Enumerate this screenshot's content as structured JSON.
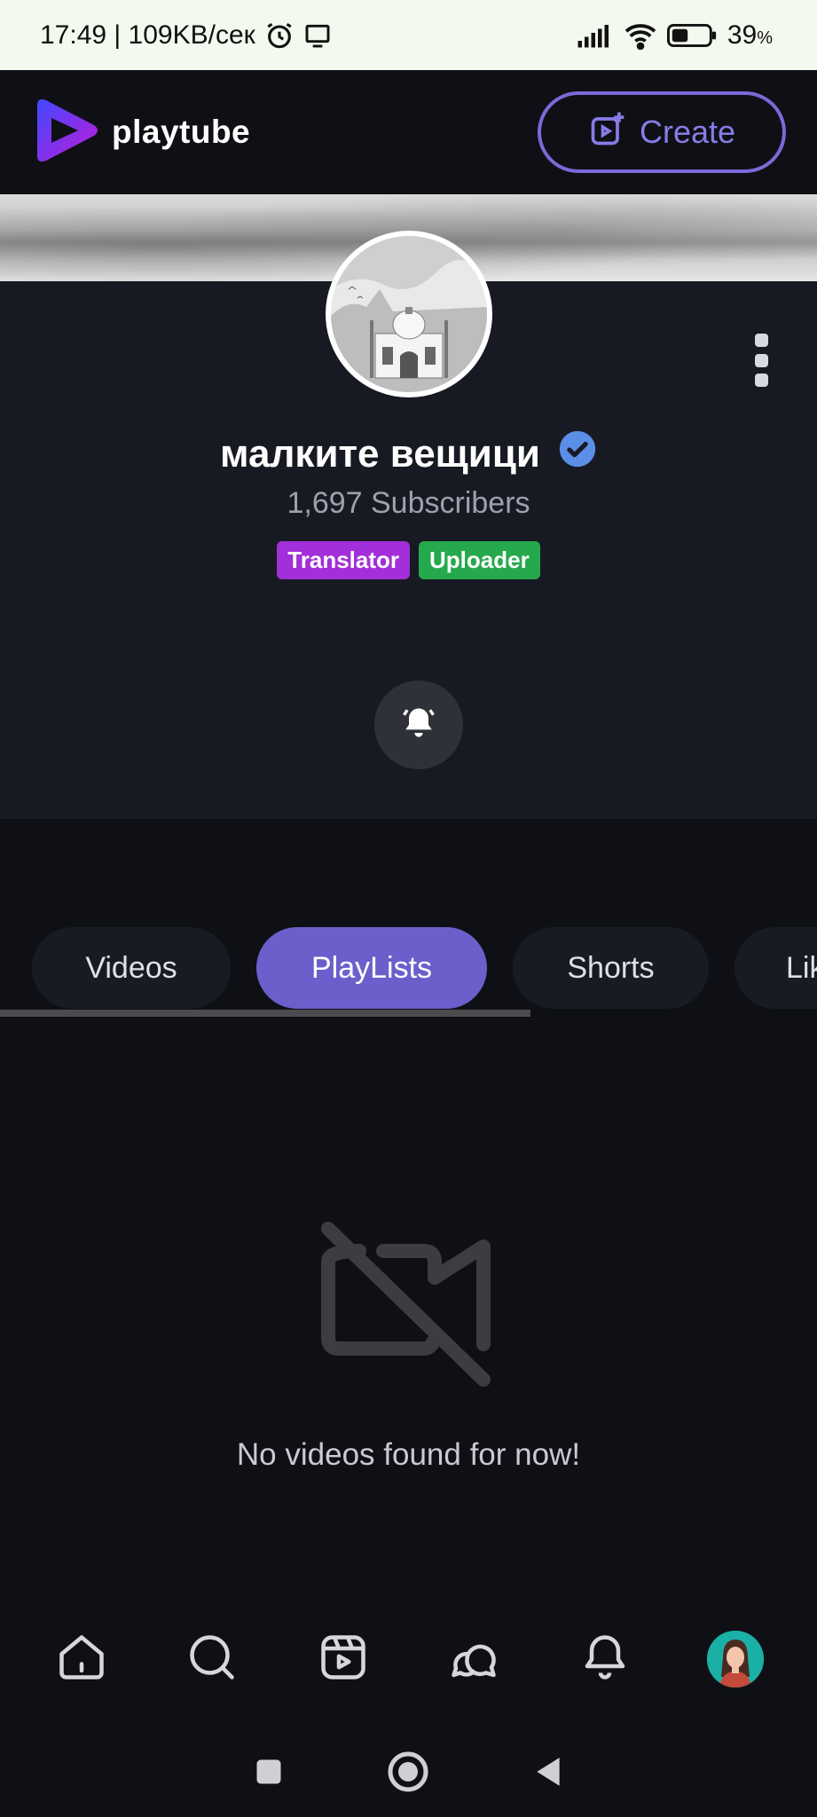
{
  "status_bar": {
    "time_speed": "17:49 | 109KB/сек",
    "battery": "39",
    "battery_unit": "%",
    "icons": [
      "alarm-icon",
      "cast-icon",
      "signal-icon",
      "wifi-icon",
      "battery-icon"
    ]
  },
  "app_bar": {
    "brand": "playtube",
    "create_label": "Create",
    "accent": "#7b6ad8"
  },
  "profile": {
    "channel_name": "малките вещици",
    "verified": true,
    "subscribers": "1,697 Subscribers",
    "badges": [
      {
        "label": "Translator",
        "color": "#a22fd9"
      },
      {
        "label": "Uploader",
        "color": "#25a94c"
      }
    ]
  },
  "tabs": [
    {
      "label": "Videos",
      "active": false
    },
    {
      "label": "PlayLists",
      "active": true
    },
    {
      "label": "Shorts",
      "active": false
    },
    {
      "label": "Lik",
      "active": false
    }
  ],
  "empty_state": {
    "message": "No videos found for now!",
    "icon": "video-off-icon"
  },
  "bottom_nav": {
    "items": [
      "home-icon",
      "search-icon",
      "shorts-icon",
      "chat-icon",
      "notifications-icon",
      "profile-avatar"
    ]
  },
  "system_nav": [
    "recents-icon",
    "home-circle-icon",
    "back-icon"
  ]
}
